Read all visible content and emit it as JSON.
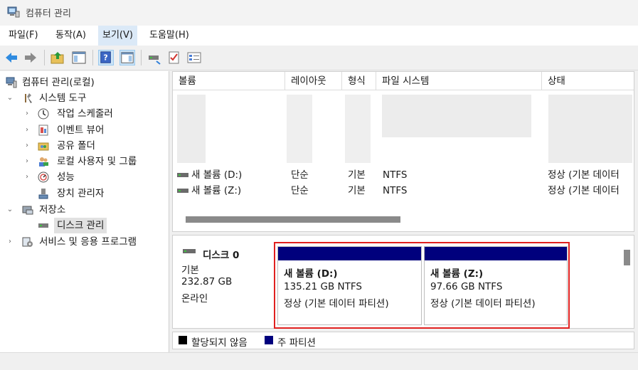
{
  "window": {
    "title": "컴퓨터 관리"
  },
  "menu": [
    {
      "label": "파일(F)"
    },
    {
      "label": "동작(A)"
    },
    {
      "label": "보기(V)"
    },
    {
      "label": "도움말(H)"
    }
  ],
  "tree": {
    "root": "컴퓨터 관리(로컬)",
    "system_tools": "시스템 도구",
    "task_scheduler": "작업 스케줄러",
    "event_viewer": "이벤트 뷰어",
    "shared_folders": "공유 폴더",
    "local_users": "로컬 사용자 및 그룹",
    "performance": "성능",
    "device_manager": "장치 관리자",
    "storage": "저장소",
    "disk_management": "디스크 관리",
    "services_apps": "서비스 및 응용 프로그램"
  },
  "volume_list": {
    "columns": [
      "볼륨",
      "레이아웃",
      "형식",
      "파일 시스템",
      "상태"
    ],
    "rows": [
      {
        "volume": "새 볼륨 (D:)",
        "layout": "단순",
        "type": "기본",
        "fs": "NTFS",
        "status": "정상 (기본 데이터"
      },
      {
        "volume": "새 볼륨 (Z:)",
        "layout": "단순",
        "type": "기본",
        "fs": "NTFS",
        "status": "정상 (기본 데이터"
      }
    ]
  },
  "disk": {
    "name": "디스크 0",
    "type": "기본",
    "size": "232.87 GB",
    "state": "온라인",
    "partitions": [
      {
        "name": "새 볼륨  (D:)",
        "size": "135.21 GB NTFS",
        "status": "정상 (기본 데이터 파티션)"
      },
      {
        "name": "새 볼륨  (Z:)",
        "size": "97.66 GB NTFS",
        "status": "정상 (기본 데이터 파티션)"
      }
    ]
  },
  "legend": [
    {
      "label": "할당되지 않음",
      "color": "#000000"
    },
    {
      "label": "주 파티션",
      "color": "#00007d"
    }
  ],
  "colors": {
    "accent": "#00007d",
    "highlight_border": "#e0201f",
    "menu_active": "#dbe9f7"
  }
}
